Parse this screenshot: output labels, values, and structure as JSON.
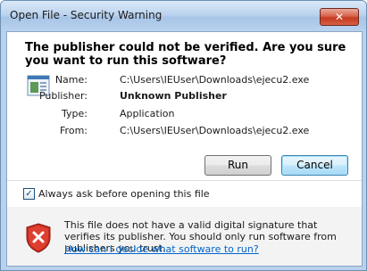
{
  "window": {
    "title": "Open File - Security Warning",
    "close_glyph": "✕"
  },
  "headline": "The publisher could not be verified.  Are you sure you want to run this software?",
  "details": {
    "name_label": "Name:",
    "name_value": "C:\\Users\\IEUser\\Downloads\\ejecu2.exe",
    "publisher_label": "Publisher:",
    "publisher_value": "Unknown Publisher",
    "type_label": "Type:",
    "type_value": "Application",
    "from_label": "From:",
    "from_value": "C:\\Users\\IEUser\\Downloads\\ejecu2.exe"
  },
  "buttons": {
    "run_label": "Run",
    "cancel_label": "Cancel"
  },
  "checkbox": {
    "label": "Always ask before opening this file",
    "checked": true,
    "check_glyph": "✓"
  },
  "warning": {
    "text": "This file does not have a valid digital signature that verifies its publisher.  You should only run software from publishers you trust.",
    "link": "How can I decide what software to run?"
  },
  "icons": {
    "file": "application-file-icon",
    "shield": "security-shield-error-icon"
  }
}
